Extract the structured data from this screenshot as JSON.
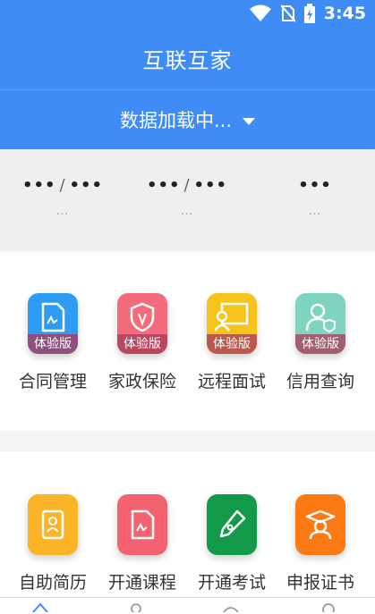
{
  "status_bar": {
    "time": "3:45",
    "icons": [
      "wifi-icon",
      "no-sim-icon",
      "battery-charging-icon"
    ]
  },
  "header": {
    "title": "互联互家"
  },
  "org_selector": {
    "label": "数据加载中...",
    "icon": "caret-down-icon"
  },
  "stats": [
    {
      "value": "•••",
      "total": "•••",
      "sub": "…"
    },
    {
      "value": "•••",
      "total": "•••",
      "sub": "…"
    },
    {
      "value": "•••",
      "sub": "…"
    }
  ],
  "services": [
    {
      "label": "合同管理",
      "badge": "体验版",
      "icon": "contract-icon",
      "color": "#2f9cf3"
    },
    {
      "label": "家政保险",
      "badge": "体验版",
      "icon": "shield-icon",
      "color": "#f36b7c"
    },
    {
      "label": "远程面试",
      "badge": "体验版",
      "icon": "video-interview-icon",
      "color": "#f6c31c"
    },
    {
      "label": "信用查询",
      "badge": "体验版",
      "icon": "credit-user-icon",
      "color": "#7ed4be"
    }
  ],
  "tools": [
    {
      "label": "自助简历",
      "icon": "resume-id-icon",
      "color": "#fbb428"
    },
    {
      "label": "开通课程",
      "icon": "course-doc-icon",
      "color": "#f2636f"
    },
    {
      "label": "开通考试",
      "icon": "pen-exam-icon",
      "color": "#13994a"
    },
    {
      "label": "申报证书",
      "icon": "graduate-cert-icon",
      "color": "#fb7a14"
    }
  ],
  "tab_bar": {
    "tabs": [
      "home-tab-icon",
      "person-tab-icon",
      "message-tab-icon",
      "profile-tab-icon"
    ]
  }
}
